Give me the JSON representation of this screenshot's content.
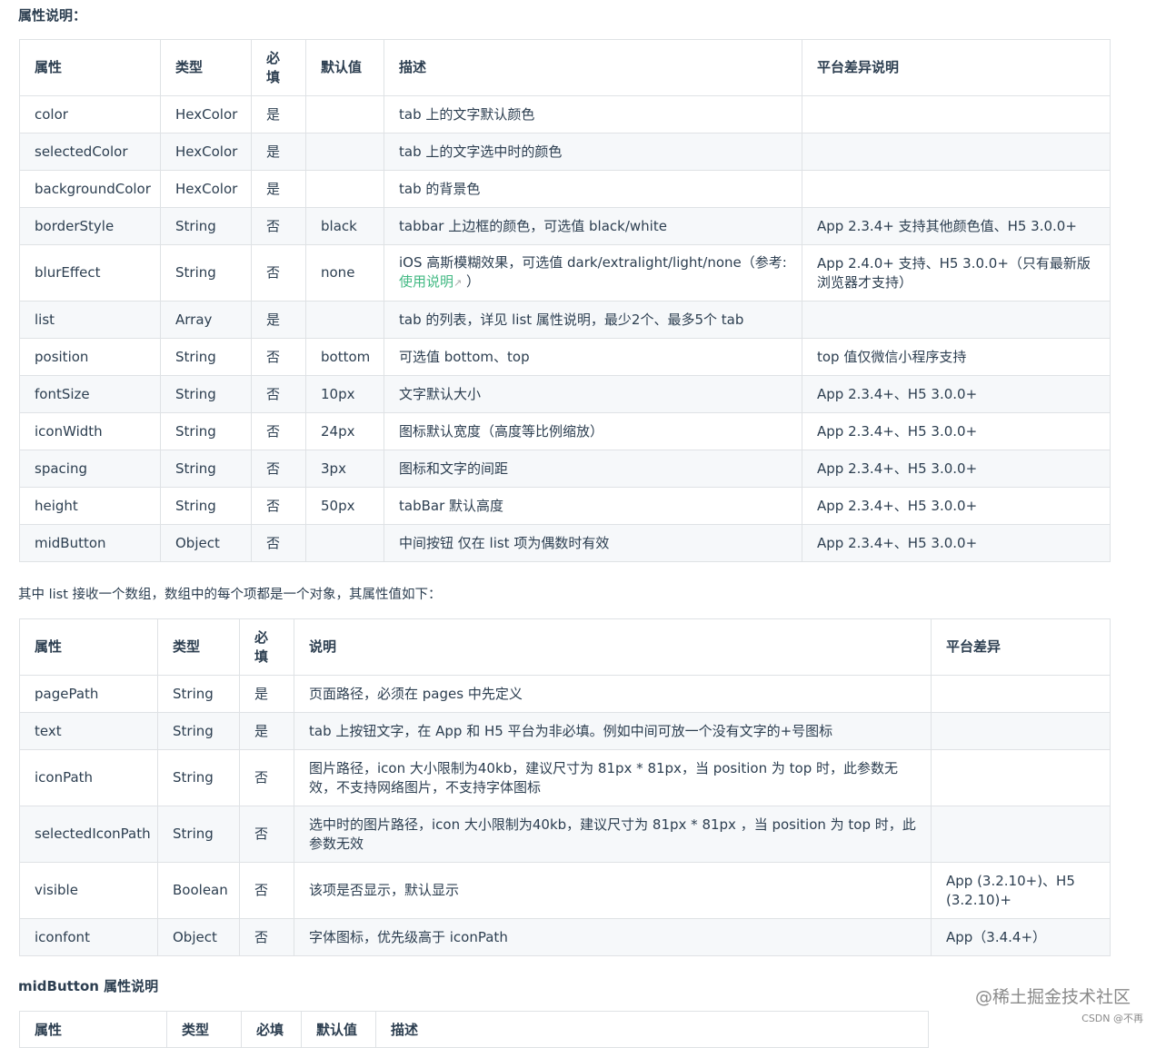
{
  "section1": {
    "title": "属性说明：",
    "headers": [
      "属性",
      "类型",
      "必填",
      "默认值",
      "描述",
      "平台差异说明"
    ],
    "rows": [
      {
        "name": "color",
        "type": "HexColor",
        "required": "是",
        "default": "",
        "desc": "tab 上的文字默认颜色",
        "platform": ""
      },
      {
        "name": "selectedColor",
        "type": "HexColor",
        "required": "是",
        "default": "",
        "desc": "tab 上的文字选中时的颜色",
        "platform": ""
      },
      {
        "name": "backgroundColor",
        "type": "HexColor",
        "required": "是",
        "default": "",
        "desc": "tab 的背景色",
        "platform": ""
      },
      {
        "name": "borderStyle",
        "type": "String",
        "required": "否",
        "default": "black",
        "desc": "tabbar 上边框的颜色，可选值 black/white",
        "platform": "App 2.3.4+ 支持其他颜色值、H5 3.0.0+"
      },
      {
        "name": "blurEffect",
        "type": "String",
        "required": "否",
        "default": "none",
        "desc": "iOS 高斯模糊效果，可选值 dark/extralight/light/none（参考:",
        "desc_link": "使用说明",
        "desc_end": "）",
        "platform": "App 2.4.0+ 支持、H5 3.0.0+（只有最新版浏览器才支持）"
      },
      {
        "name": "list",
        "type": "Array",
        "required": "是",
        "default": "",
        "desc": "tab 的列表，详见 list 属性说明，最少2个、最多5个 tab",
        "platform": ""
      },
      {
        "name": "position",
        "type": "String",
        "required": "否",
        "default": "bottom",
        "desc": "可选值 bottom、top",
        "platform": "top 值仅微信小程序支持"
      },
      {
        "name": "fontSize",
        "type": "String",
        "required": "否",
        "default": "10px",
        "desc": "文字默认大小",
        "platform": "App 2.3.4+、H5 3.0.0+"
      },
      {
        "name": "iconWidth",
        "type": "String",
        "required": "否",
        "default": "24px",
        "desc": "图标默认宽度（高度等比例缩放）",
        "platform": "App 2.3.4+、H5 3.0.0+"
      },
      {
        "name": "spacing",
        "type": "String",
        "required": "否",
        "default": "3px",
        "desc": "图标和文字的间距",
        "platform": "App 2.3.4+、H5 3.0.0+"
      },
      {
        "name": "height",
        "type": "String",
        "required": "否",
        "default": "50px",
        "desc": "tabBar 默认高度",
        "platform": "App 2.3.4+、H5 3.0.0+"
      },
      {
        "name": "midButton",
        "type": "Object",
        "required": "否",
        "default": "",
        "desc": "中间按钮 仅在 list 项为偶数时有效",
        "platform": "App 2.3.4+、H5 3.0.0+"
      }
    ]
  },
  "list_intro": "其中 list 接收一个数组，数组中的每个项都是一个对象，其属性值如下：",
  "section2": {
    "headers": [
      "属性",
      "类型",
      "必填",
      "说明",
      "平台差异"
    ],
    "rows": [
      {
        "name": "pagePath",
        "type": "String",
        "required": "是",
        "desc": "页面路径，必须在 pages 中先定义",
        "platform": ""
      },
      {
        "name": "text",
        "type": "String",
        "required": "是",
        "desc": "tab 上按钮文字，在 App 和 H5 平台为非必填。例如中间可放一个没有文字的+号图标",
        "platform": ""
      },
      {
        "name": "iconPath",
        "type": "String",
        "required": "否",
        "desc": "图片路径，icon 大小限制为40kb，建议尺寸为 81px * 81px，当 position 为 top 时，此参数无效，不支持网络图片，不支持字体图标",
        "platform": ""
      },
      {
        "name": "selectedIconPath",
        "type": "String",
        "required": "否",
        "desc": "选中时的图片路径，icon 大小限制为40kb，建议尺寸为 81px * 81px ，当 position 为 top 时，此参数无效",
        "platform": ""
      },
      {
        "name": "visible",
        "type": "Boolean",
        "required": "否",
        "desc": "该项是否显示，默认显示",
        "platform": "App (3.2.10+)、H5 (3.2.10)+"
      },
      {
        "name": "iconfont",
        "type": "Object",
        "required": "否",
        "desc": "字体图标，优先级高于 iconPath",
        "platform": "App（3.4.4+）"
      }
    ]
  },
  "section3": {
    "title": "midButton 属性说明",
    "headers": [
      "属性",
      "类型",
      "必填",
      "默认值",
      "描述"
    ]
  },
  "watermark": "@稀土掘金技术社区",
  "watermark_small": "CSDN @不再"
}
